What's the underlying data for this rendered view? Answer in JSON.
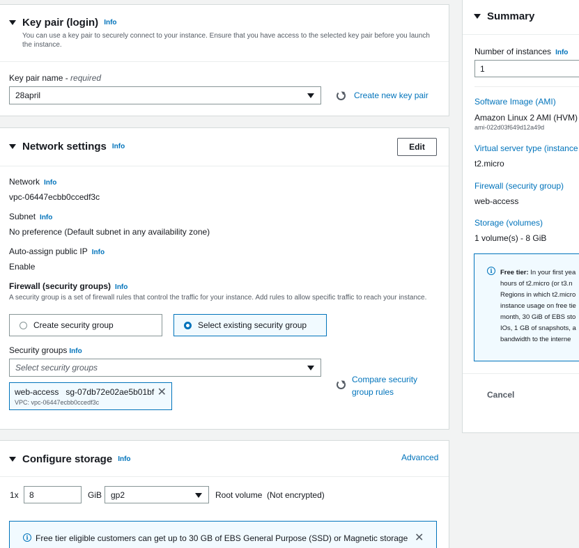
{
  "key_pair": {
    "title": "Key pair (login)",
    "info": "Info",
    "description": "You can use a key pair to securely connect to your instance. Ensure that you have access to the selected key pair before you launch the instance.",
    "name_label": "Key pair name",
    "required": "required",
    "selected": "28april",
    "create_link": "Create new key pair"
  },
  "network": {
    "title": "Network settings",
    "info": "Info",
    "edit_button": "Edit",
    "network_label": "Network",
    "network_value": "vpc-06447ecbb0ccedf3c",
    "subnet_label": "Subnet",
    "subnet_value": "No preference (Default subnet in any availability zone)",
    "public_ip_label": "Auto-assign public IP",
    "public_ip_value": "Enable",
    "firewall_label": "Firewall (security groups)",
    "firewall_desc": "A security group is a set of firewall rules that control the traffic for your instance. Add rules to allow specific traffic to reach your instance.",
    "create_sg": "Create security group",
    "select_sg": "Select existing security group",
    "sg_label": "Security groups",
    "sg_placeholder": "Select security groups",
    "token_name": "web-access",
    "token_id": "sg-07db72e02ae5b01bf",
    "token_vpc": "VPC: vpc-06447ecbb0ccedf3c",
    "compare_link_1": "Compare security",
    "compare_link_2": "group rules"
  },
  "storage": {
    "title": "Configure storage",
    "info": "Info",
    "advanced": "Advanced",
    "count": "1x",
    "size": "8",
    "unit": "GiB",
    "type": "gp2",
    "root_label": "Root volume",
    "encryption": "(Not encrypted)",
    "alert_text": "Free tier eligible customers can get up to 30 GB of EBS General Purpose (SSD) or Magnetic storage"
  },
  "summary": {
    "title": "Summary",
    "instances_label": "Number of instances",
    "info": "Info",
    "instances_value": "1",
    "ami_label": "Software Image (AMI)",
    "ami_value": "Amazon Linux 2 AMI (HVM) -",
    "ami_id": "ami-022d03f649d12a49d",
    "type_label": "Virtual server type (instance",
    "type_value": "t2.micro",
    "firewall_label": "Firewall (security group)",
    "firewall_value": "web-access",
    "storage_label": "Storage (volumes)",
    "storage_value": "1 volume(s) - 8 GiB",
    "free_tier_bold": "Free tier:",
    "free_tier_lines": [
      "In your first yea",
      "hours of t2.micro (or t3.n",
      "Regions in which t2.micro",
      "instance usage on free tie",
      "month, 30 GiB of EBS sto",
      "IOs, 1 GB of snapshots, a",
      "bandwidth to the interne"
    ],
    "cancel": "Cancel"
  }
}
